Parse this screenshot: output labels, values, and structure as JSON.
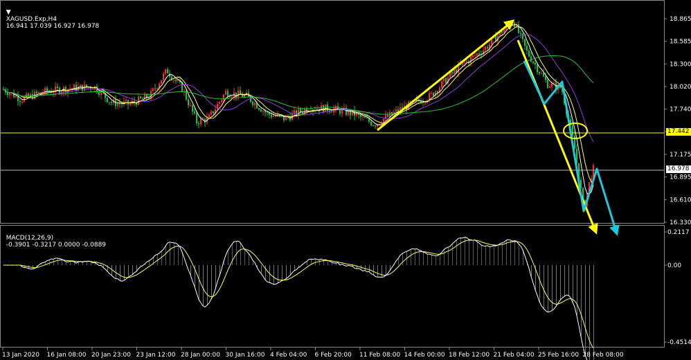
{
  "main_header": {
    "symbol_label": "XAGUSD.Exp,H4",
    "ohlc": "16.941 17.039 16.927 16.978"
  },
  "macd_header": {
    "label": "MACD(12,26,9)",
    "values": "-0.3901 -0.3217 0.0000 -0.0889"
  },
  "price_axis": {
    "ticks": [
      "18.865",
      "18.585",
      "18.300",
      "18.020",
      "17.740",
      "17.460",
      "17.175",
      "16.895",
      "16.610",
      "16.330"
    ]
  },
  "price_tags": {
    "level_line": "17.442",
    "current_price": "16.978"
  },
  "macd_axis": {
    "ticks": [
      "0.2117",
      "0.00",
      "-0.4514"
    ]
  },
  "time_axis": {
    "labels": [
      "13 Jan 2020",
      "16 Jan 08:00",
      "20 Jan 23:00",
      "23 Jan 12:00",
      "28 Jan 00:00",
      "30 Jan 16:00",
      "4 Feb 04:00",
      "6 Feb 20:00",
      "11 Feb 08:00",
      "14 Feb 00:00",
      "18 Feb 12:00",
      "21 Feb 04:00",
      "25 Feb 16:00",
      "28 Feb 08:00"
    ]
  },
  "colors": {
    "background": "#000000",
    "bull_candle": "#ff2a2a",
    "bear_candle": "#19c73b",
    "ma_fast": "#ffffff",
    "ma_mid": "#ffff66",
    "ma_slow": "#8f3dd6",
    "ma_long": "#2fbf3f",
    "level_line": "#ffff00",
    "arrow_yellow": "#ffff00",
    "arrow_cyan": "#1ec8dc",
    "macd_pos": "#d8231f",
    "macd_neg": "#3aa33a"
  },
  "icons": {
    "collapse": "triangle-down-icon"
  }
}
